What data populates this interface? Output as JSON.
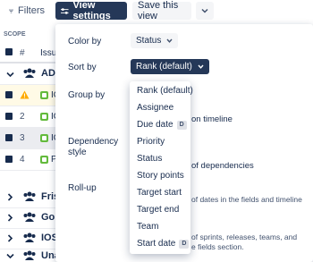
{
  "toolbar": {
    "filters_label": "Filters",
    "view_settings_label": "View settings",
    "save_view_label": "Save this view"
  },
  "table": {
    "scope_label": "SCOPE",
    "header_number": "#",
    "header_issue": "Issu",
    "group_top_name": "ADF",
    "rows": [
      {
        "num": "1",
        "key": "IC",
        "warning": true
      },
      {
        "num": "2",
        "key": "IC"
      },
      {
        "num": "3",
        "key": "IC"
      },
      {
        "num": "4",
        "key": "P"
      }
    ],
    "right_trunc": "b",
    "groups": [
      {
        "name": "Fris"
      },
      {
        "name": "Gor"
      },
      {
        "name": "IOS"
      },
      {
        "name": "Unassigned"
      }
    ]
  },
  "panel": {
    "color_by_label": "Color by",
    "color_by_value": "Status",
    "sort_by_label": "Sort by",
    "sort_by_value": "Rank (default)",
    "group_by_label": "Group by",
    "dependency_label": "Dependency",
    "style_label": "style",
    "rollup_label": "Roll-up",
    "show_on_timeline_text": "on timeline",
    "show_dependencies_text": "of dependencies",
    "rollup_dates_text": "of dates in the fields and timeline",
    "rollup_sprints_text_1": "of sprints, releases, teams, and",
    "rollup_sprints_text_2": "e fields section."
  },
  "dropdown": {
    "options": [
      {
        "label": "Rank (default)",
        "badge": ""
      },
      {
        "label": "Assignee",
        "badge": ""
      },
      {
        "label": "Due date",
        "badge": "D"
      },
      {
        "label": "Priority",
        "badge": ""
      },
      {
        "label": "Status",
        "badge": ""
      },
      {
        "label": "Story points",
        "badge": ""
      },
      {
        "label": "Target start",
        "badge": ""
      },
      {
        "label": "Target end",
        "badge": ""
      },
      {
        "label": "Team",
        "badge": ""
      },
      {
        "label": "Start date",
        "badge": "D"
      }
    ]
  },
  "colors": {
    "primary_dark": "#253858",
    "accent_blue": "#0052cc",
    "warning": "#ffab00",
    "story_green": "#63ba3c"
  }
}
